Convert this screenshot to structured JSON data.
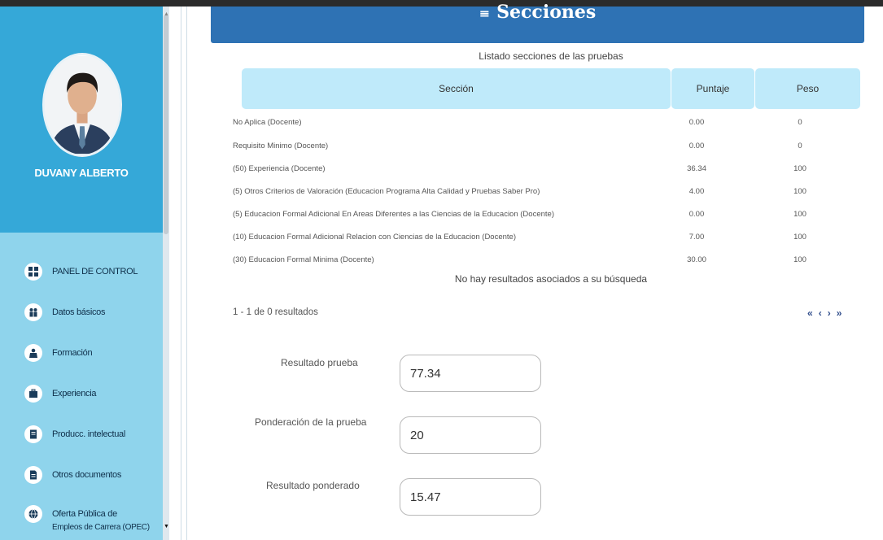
{
  "page": {
    "title": "Secciones",
    "caption": "Listado secciones de las pruebas"
  },
  "profile": {
    "name": "DUVANY ALBERTO"
  },
  "nav": [
    {
      "label": "PANEL DE CONTROL",
      "icon": "dashboard-icon"
    },
    {
      "label": "Datos básicos",
      "icon": "users-icon"
    },
    {
      "label": "Formación",
      "icon": "graduate-icon"
    },
    {
      "label": "Experiencia",
      "icon": "briefcase-icon"
    },
    {
      "label": "Producc. intelectual",
      "icon": "book-icon"
    },
    {
      "label": "Otros documentos",
      "icon": "document-icon"
    },
    {
      "label": "Oferta Pública de",
      "label2": "Empleos de Carrera (OPEC)",
      "icon": "globe-icon"
    }
  ],
  "table": {
    "headers": [
      "Sección",
      "Puntaje",
      "Peso"
    ],
    "rows": [
      {
        "seccion": "No Aplica (Docente)",
        "puntaje": "0.00",
        "peso": "0"
      },
      {
        "seccion": "Requisito Minimo (Docente)",
        "puntaje": "0.00",
        "peso": "0"
      },
      {
        "seccion": "(50) Experiencia (Docente)",
        "puntaje": "36.34",
        "peso": "100"
      },
      {
        "seccion": "(5) Otros Criterios de Valoración (Educacion Programa Alta Calidad y Pruebas Saber Pro)",
        "puntaje": "4.00",
        "peso": "100"
      },
      {
        "seccion": "(5) Educacion Formal Adicional En Areas Diferentes a las Ciencias de la Educacion (Docente)",
        "puntaje": "0.00",
        "peso": "100"
      },
      {
        "seccion": "(10) Educacion Formal Adicional Relacion con Ciencias de la Educacion (Docente)",
        "puntaje": "7.00",
        "peso": "100"
      },
      {
        "seccion": "(30) Educacion Formal Minima (Docente)",
        "puntaje": "30.00",
        "peso": "100"
      }
    ],
    "no_results": "No hay resultados asociados a su búsqueda",
    "pagination_info": "1 - 1 de 0 resultados",
    "pager": {
      "first": "«",
      "prev": "‹",
      "next": "›",
      "last": "»"
    }
  },
  "results": {
    "resultado_prueba": {
      "label": "Resultado prueba",
      "value": "77.34"
    },
    "ponderacion": {
      "label": "Ponderación de la prueba",
      "value": "20"
    },
    "resultado_ponderado": {
      "label": "Resultado ponderado",
      "value": "15.47"
    }
  },
  "colors": {
    "header": "#2e72b4",
    "sidebar": "#8fd4ec",
    "profile": "#35a8d8",
    "table_header": "#bfeafa"
  }
}
